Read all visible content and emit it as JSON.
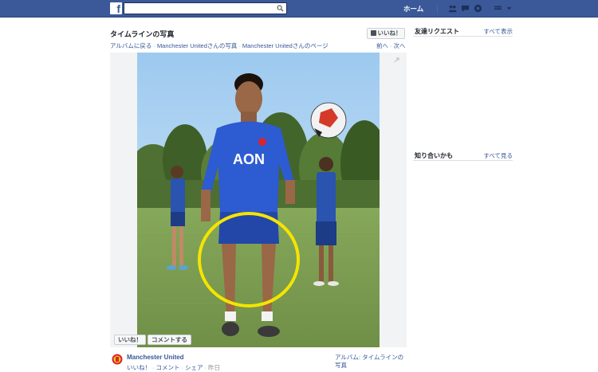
{
  "topbar": {
    "logo": "f",
    "search_placeholder": "",
    "home_label": "ホーム"
  },
  "photo": {
    "title": "タイムラインの写真",
    "like_button": "いいね！",
    "breadcrumb": [
      "アルバムに戻る",
      "Manchester Unitedさんの写真",
      "Manchester Unitedさんのページ"
    ],
    "nav_prev": "前へ",
    "nav_next": "次へ",
    "overlay_like": "いいね！",
    "overlay_comment": "コメントする",
    "jersey_text": "AON",
    "highlight_color": "#f5e400"
  },
  "footer": {
    "page_name": "Manchester United",
    "actions": [
      "いいね！",
      "コメント",
      "シェア",
      "昨日"
    ],
    "album_text": "アルバム: タイムラインの写真"
  },
  "sidebar": {
    "friend_requests": {
      "title": "友達リクエスト",
      "link": "すべて表示"
    },
    "people_you_may_know": {
      "title": "知り合いかも",
      "link": "すべて見る"
    }
  },
  "colors": {
    "brand": "#3b5998",
    "link": "#365899"
  }
}
